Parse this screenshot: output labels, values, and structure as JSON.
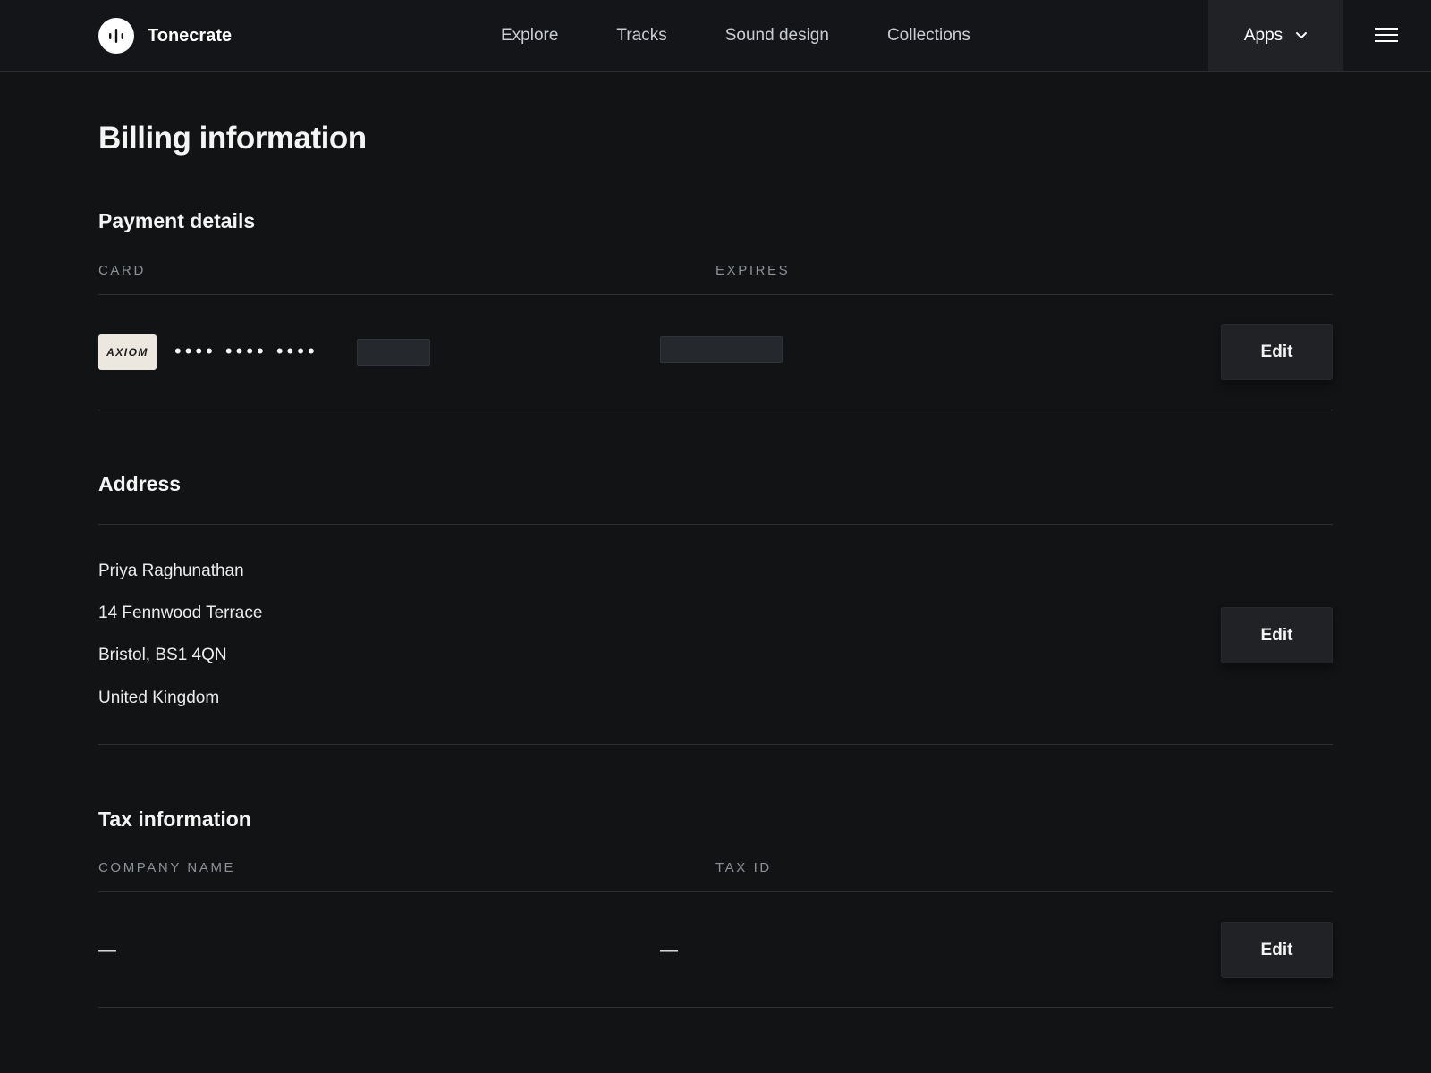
{
  "header": {
    "brand": "Tonecrate",
    "nav": [
      "Explore",
      "Tracks",
      "Sound design",
      "Collections"
    ],
    "apps_label": "Apps"
  },
  "page_title": "Billing information",
  "payment": {
    "title": "Payment details",
    "card_label": "CARD",
    "expires_label": "EXPIRES",
    "card_brand": "AXIOM",
    "card_mask": "•••• •••• ••••",
    "edit_label": "Edit"
  },
  "address": {
    "title": "Address",
    "lines": [
      "Priya Raghunathan",
      "14 Fennwood Terrace",
      "Bristol, BS1 4QN",
      "United Kingdom"
    ],
    "edit_label": "Edit"
  },
  "tax": {
    "title": "Tax information",
    "company_label": "COMPANY NAME",
    "taxid_label": "TAX ID",
    "company_value": "—",
    "taxid_value": "—",
    "edit_label": "Edit"
  },
  "colors": {
    "background": "#111315",
    "button": "#202226",
    "card_brand_bg": "#ece8df"
  }
}
